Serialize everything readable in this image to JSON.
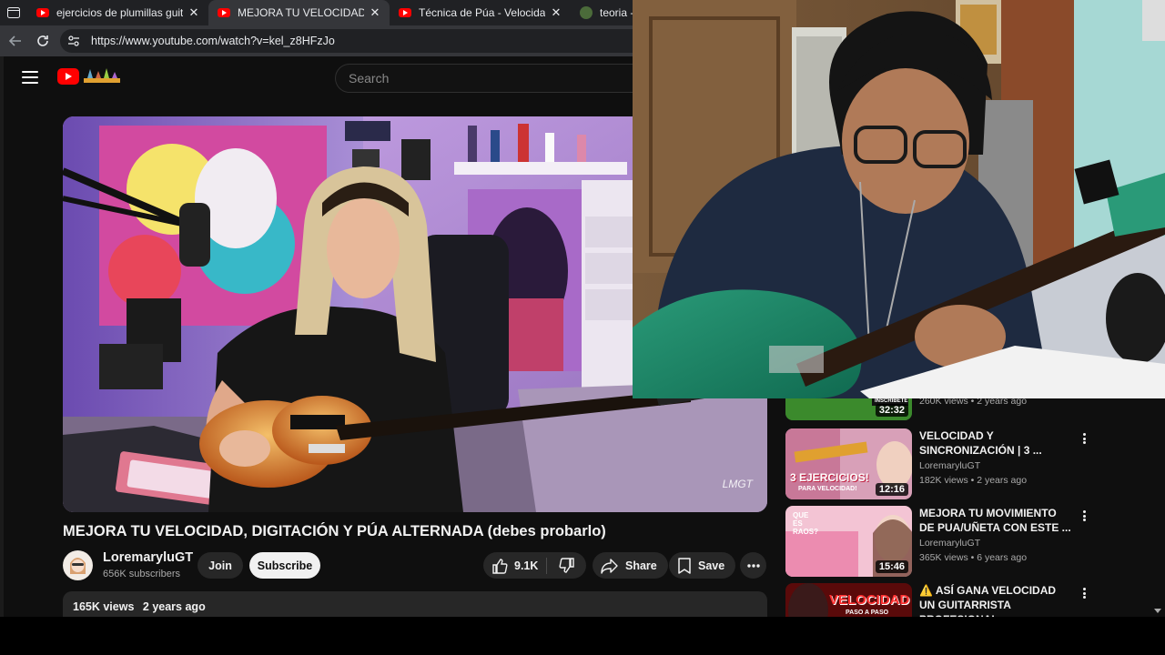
{
  "browser": {
    "tabs": [
      {
        "title": "ejercicios de plumillas guitarra - Y",
        "active": false,
        "favicon": "youtube-icon"
      },
      {
        "title": "MEJORA TU VELOCIDAD, DIGITAC",
        "active": true,
        "favicon": "youtube-icon"
      },
      {
        "title": "Técnica de Púa - Velocidad - Prec",
        "active": false,
        "favicon": "youtube-icon"
      },
      {
        "title": "teoria -",
        "active": false,
        "favicon": "globe-icon"
      }
    ],
    "url": "https://www.youtube.com/watch?v=kel_z8HFzJo"
  },
  "youtube": {
    "search_placeholder": "Search",
    "video": {
      "title": "MEJORA TU VELOCIDAD, DIGITACIÓN Y PÚA ALTERNADA (debes probarlo)",
      "watermark": "LMGT",
      "channel": "LoremaryluGT",
      "subscribers": "656K subscribers",
      "join_label": "Join",
      "subscribe_label": "Subscribe",
      "likes": "9.1K",
      "share_label": "Share",
      "save_label": "Save",
      "views": "165K views",
      "age": "2 years ago"
    },
    "recommendations": [
      {
        "title": "",
        "channel": "",
        "meta": "260K views • 2 years ago",
        "duration": "32:32",
        "thumb_text": "INSCRIBETE",
        "thumb_color": "#3a7a2a"
      },
      {
        "title": "VELOCIDAD Y SINCRONIZACIÓN | 3 ...",
        "channel": "LoremaryluGT",
        "meta": "182K views • 2 years ago",
        "duration": "12:16",
        "thumb_text": "3 EJERCICIOS!",
        "thumb_sub": "PARA VELOCIDAD!",
        "thumb_color": "#c2567a"
      },
      {
        "title": "MEJORA TU MOVIMIENTO DE PUA/UÑETA CON ESTE ...",
        "channel": "LoremaryluGT",
        "meta": "365K views • 6 years ago",
        "duration": "15:46",
        "thumb_text": "QUE ES RAOS?",
        "thumb_color": "#e8a0b8"
      },
      {
        "title": "⚠️ ASÍ GANA VELOCIDAD UN GUITARRISTA PROFESIONAL ...",
        "channel": "",
        "meta": "",
        "duration": "",
        "thumb_text": "VELOCIDAD",
        "thumb_sub": "PASO A PASO",
        "thumb_color": "#7a1010"
      }
    ]
  },
  "colors": {
    "yt_red": "#ff0000",
    "bg": "#0f0f0f",
    "chip": "#272727"
  }
}
